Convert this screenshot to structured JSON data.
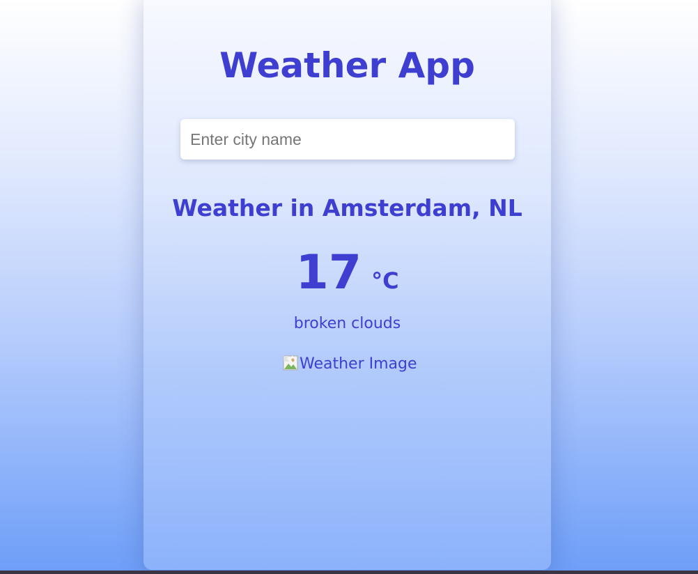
{
  "app": {
    "title": "Weather App"
  },
  "search": {
    "placeholder": "Enter city name",
    "value": ""
  },
  "weather": {
    "location": "Weather in Amsterdam, NL",
    "temperature": "17",
    "unit": "°C",
    "description": "broken clouds",
    "image_alt": "Weather Image"
  },
  "icons": {
    "weather_image": "broken-image-icon"
  },
  "colors": {
    "accent": "#3e3fd0",
    "background_top": "#ffffff",
    "background_bottom": "#6d9ef8",
    "card_top": "#f9faff",
    "card_bottom": "#8cb2fb",
    "input_background": "#ffffff",
    "placeholder": "#767676"
  }
}
